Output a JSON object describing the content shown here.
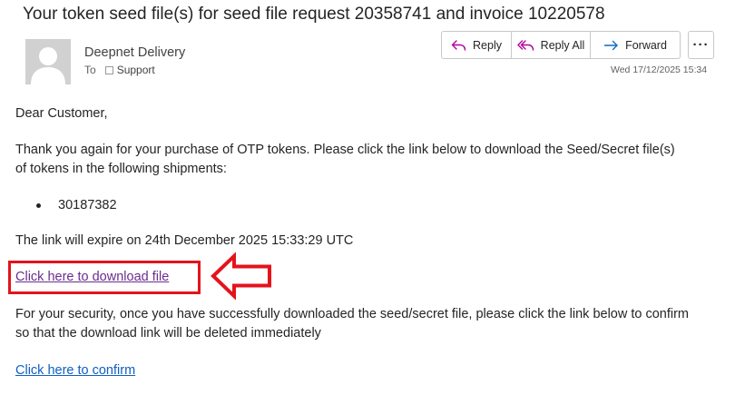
{
  "email": {
    "subject": "Your token seed file(s) for seed file request 20358741 and invoice 10220578",
    "sender": "Deepnet Delivery",
    "to_label": "To",
    "recipient": "Support",
    "timestamp": "Wed 17/12/2025 15:34"
  },
  "actions": {
    "reply_label": "Reply",
    "reply_all_label": "Reply All",
    "forward_label": "Forward",
    "more_label": "···"
  },
  "body": {
    "greeting": "Dear Customer,",
    "para1_line1": "Thank you again for your purchase of OTP tokens. Please click the link below to download the Seed/Secret file(s)",
    "para1_line2": "of tokens in the following shipments:",
    "shipments": [
      "30187382"
    ],
    "expiry": "The link will expire on 24th December 2025 15:33:29 UTC",
    "download_link": "Click here to download file",
    "para2_line1": "For your security, once you have successfully downloaded the seed/secret file, please click the link below to confirm",
    "para2_line2": "so that the download link will be deleted immediately",
    "confirm_link": "Click here to confirm"
  },
  "colors": {
    "highlight_red": "#e3141c",
    "visited_link": "#6b2c91",
    "link": "#0f5fc2",
    "reply_icon": "#b4009e",
    "forward_icon": "#0f6cbd"
  },
  "icons": [
    "reply-icon",
    "reply-all-icon",
    "forward-icon",
    "more-icon",
    "avatar-placeholder-icon",
    "annotation-arrow"
  ]
}
